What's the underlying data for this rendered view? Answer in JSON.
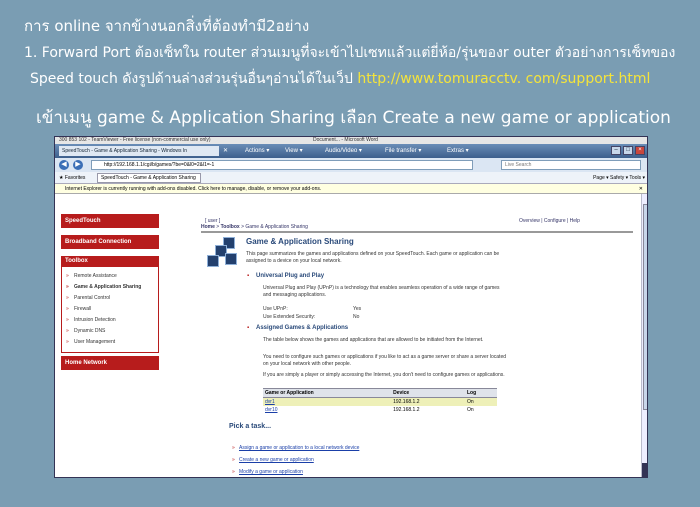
{
  "captions": {
    "line1": "การ online จากข้างนอกสิ่งที่ต้องทำมี2อย่าง",
    "line2": "1.   Forward Port ต้องเซ็ทใน router ส่วนเมนูที่จะเข้าไปเซทแล้วแต่ยี่ห้อ/รุ่นของr outer ตัวอย่างการเซ็ทของ",
    "line3": "Speed touch ดังรูปด้านล่างส่วนรุ่นอื่นๆอ่านได้ในเว็ป",
    "line3_url": "http://www.tomuracctv. com/support.html",
    "line4": "เข้าเมนู game & Application Sharing เลือก Create a new game or application"
  },
  "teamviewer": {
    "title": "300 853 102 - TeamViewer - Free license (non-commercial use only)",
    "doc_title": "Document... - Microsoft Word",
    "tab": "SpeedTouch - Game & Application Sharing - Windows In",
    "close_glyph": "✕",
    "menus": [
      "Actions ▾",
      "View ▾",
      "Audio/Video ▾",
      "File transfer ▾",
      "Extras ▾"
    ]
  },
  "browser": {
    "back": "◀",
    "forward": "▶",
    "address": "http://192.168.1.1/cgi/b/games/?be=0&l0=2&l1=-1",
    "search_placeholder": "Live Search",
    "favorites": "Favorites",
    "page_tab": "SpeedTouch - Game & Application Sharing",
    "commands": "Page ▾  Safety ▾  Tools ▾",
    "infobar": "Internet Explorer is currently running with add-ons disabled. Click here to manage, disable, or remove your add-ons.",
    "infobar_close": "✕"
  },
  "sidebar": {
    "brand": "SpeedTouch",
    "broadband": "Broadband Connection",
    "toolbox": "Toolbox",
    "items": [
      "Remote Assistance",
      "Game & Application Sharing",
      "Parental Control",
      "Firewall",
      "Intrusion Detection",
      "Dynamic DNS",
      "User Management"
    ],
    "home_network": "Home Network"
  },
  "content": {
    "user_link": "[ user ]",
    "top_links": "Overview | Configure | Help",
    "crumb_home": "Home",
    "crumb_sep": " > ",
    "crumb_toolbox": "Toolbox",
    "crumb_current": "Game & Application Sharing",
    "title": "Game & Application Sharing",
    "desc": "This page summarizes the games and applications defined on your SpeedTouch. Each game or application can be assigned to a device on your local network.",
    "upnp_title": "Universal Plug and Play",
    "upnp_desc": "Universal Plug and Play (UPnP) is a technology that enables seamless operation of a wide range of games and messaging applications.",
    "use_upnp_label": "Use UPnP:",
    "use_upnp_value": "Yes",
    "ext_sec_label": "Use Extended Security:",
    "ext_sec_value": "No",
    "assigned_title": "Assigned Games & Applications",
    "assigned_p1": "The table below shows the games and applications that are allowed to be initiated from the Internet.",
    "assigned_p2": "You need to configure such games or applications if you like to act as a game server or share a server located on your local network with other people.",
    "assigned_p3": "If you are simply a player or simply accessing the Internet, you don't need to configure games or applications.",
    "table": {
      "headers": [
        "Game or Application",
        "Device",
        "Log"
      ],
      "rows": [
        [
          "dvr1",
          "192.168.1.2",
          "On"
        ],
        [
          "dvr10",
          "192.168.1.2",
          "On"
        ]
      ]
    },
    "task_title": "Pick a task...",
    "tasks": [
      "Assign a game or application to a local network device",
      "Create a new game or application",
      "Modify a game or application"
    ]
  }
}
